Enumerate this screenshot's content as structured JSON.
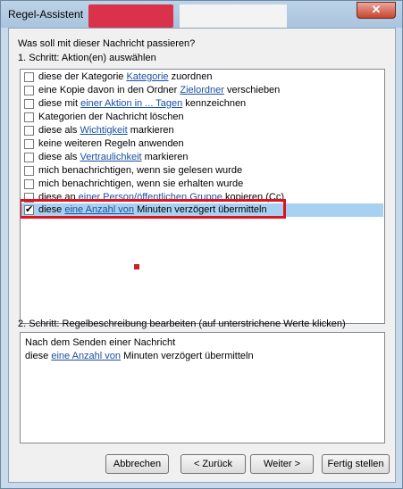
{
  "window": {
    "title": "Regel-Assistent",
    "close_glyph": "✕"
  },
  "question": "Was soll mit dieser Nachricht passieren?",
  "step1": "1. Schritt: Aktion(en) auswählen",
  "actions": [
    {
      "pre": "diese der Kategorie ",
      "link": "Kategorie",
      "post": " zuordnen",
      "checked": false
    },
    {
      "pre": "eine Kopie davon in den Ordner ",
      "link": "Zielordner",
      "post": " verschieben",
      "checked": false
    },
    {
      "pre": "diese mit ",
      "link": "einer Aktion in ... Tagen",
      "post": " kennzeichnen",
      "checked": false
    },
    {
      "pre": "Kategorien der Nachricht löschen",
      "link": "",
      "post": "",
      "checked": false
    },
    {
      "pre": "diese als ",
      "link": "Wichtigkeit",
      "post": " markieren",
      "checked": false
    },
    {
      "pre": "keine weiteren Regeln anwenden",
      "link": "",
      "post": "",
      "checked": false
    },
    {
      "pre": "diese als ",
      "link": "Vertraulichkeit",
      "post": " markieren",
      "checked": false
    },
    {
      "pre": "mich benachrichtigen, wenn sie gelesen wurde",
      "link": "",
      "post": "",
      "checked": false
    },
    {
      "pre": "mich benachrichtigen, wenn sie erhalten wurde",
      "link": "",
      "post": "",
      "checked": false
    },
    {
      "pre": "diese an ",
      "link": "einer Person/öffentlichen Gruppe",
      "post": " kopieren (Cc)",
      "checked": false
    },
    {
      "pre": "diese ",
      "link": "eine Anzahl von",
      "post": " Minuten verzögert übermitteln",
      "checked": true
    }
  ],
  "step2": "2. Schritt: Regelbeschreibung bearbeiten (auf unterstrichene Werte klicken)",
  "description": {
    "line1": "Nach dem Senden einer Nachricht",
    "line2_pre": "diese ",
    "line2_link": "eine Anzahl von",
    "line2_post": " Minuten verzögert übermitteln"
  },
  "buttons": {
    "cancel": "Abbrechen",
    "back": "< Zurück",
    "next": "Weiter >",
    "finish": "Fertig stellen"
  }
}
